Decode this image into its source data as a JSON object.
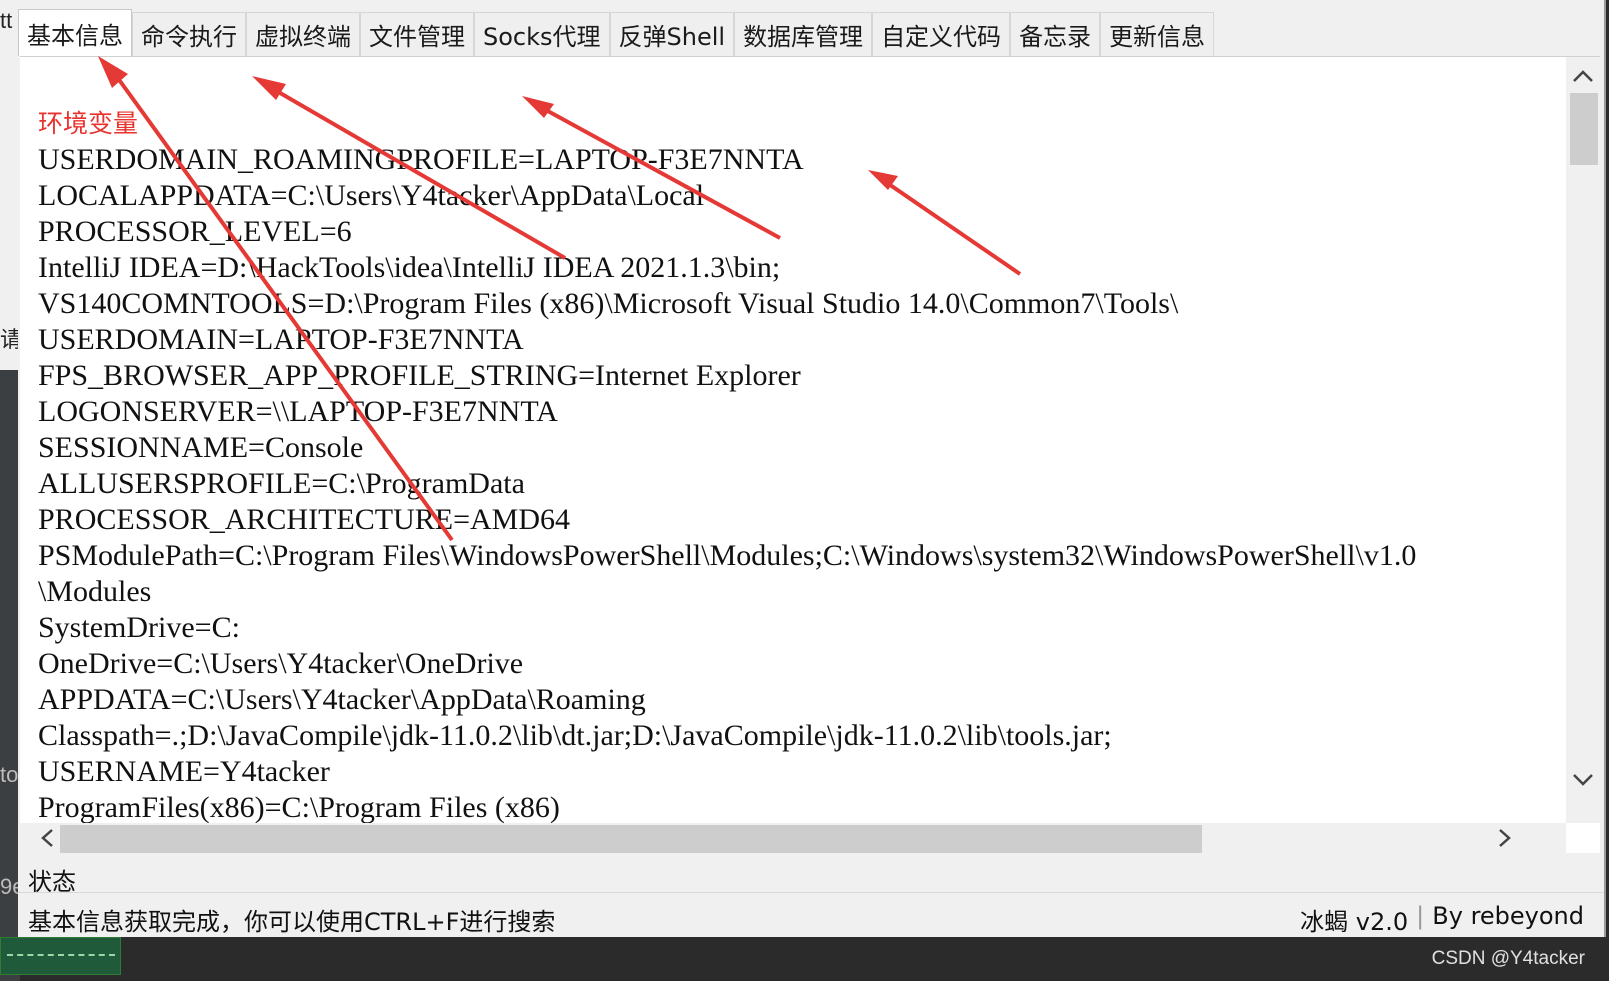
{
  "tabs": [
    {
      "label": "基本信息",
      "active": true
    },
    {
      "label": "命令执行"
    },
    {
      "label": "虚拟终端"
    },
    {
      "label": "文件管理"
    },
    {
      "label": "Socks代理"
    },
    {
      "label": "反弹Shell"
    },
    {
      "label": "数据库管理"
    },
    {
      "label": "自定义代码"
    },
    {
      "label": "备忘录"
    },
    {
      "label": "更新信息"
    }
  ],
  "content": {
    "section_title": "环境变量",
    "lines": [
      "USERDOMAIN_ROAMINGPROFILE=LAPTOP-F3E7NNTA",
      "LOCALAPPDATA=C:\\Users\\Y4tacker\\AppData\\Local",
      "PROCESSOR_LEVEL=6",
      "IntelliJ IDEA=D:\\HackTools\\idea\\IntelliJ IDEA 2021.1.3\\bin;",
      "VS140COMNTOOLS=D:\\Program Files (x86)\\Microsoft Visual Studio 14.0\\Common7\\Tools\\",
      "USERDOMAIN=LAPTOP-F3E7NNTA",
      "FPS_BROWSER_APP_PROFILE_STRING=Internet Explorer",
      "LOGONSERVER=\\\\LAPTOP-F3E7NNTA",
      "SESSIONNAME=Console",
      "ALLUSERSPROFILE=C:\\ProgramData",
      "PROCESSOR_ARCHITECTURE=AMD64",
      "PSModulePath=C:\\Program Files\\WindowsPowerShell\\Modules;C:\\Windows\\system32\\WindowsPowerShell\\v1.0",
      "\\Modules",
      "SystemDrive=C:",
      "OneDrive=C:\\Users\\Y4tacker\\OneDrive",
      "APPDATA=C:\\Users\\Y4tacker\\AppData\\Roaming",
      "Classpath=.;D:\\JavaCompile\\jdk-11.0.2\\lib\\dt.jar;D:\\JavaCompile\\jdk-11.0.2\\lib\\tools.jar;",
      "USERNAME=Y4tacker",
      "ProgramFiles(x86)=C:\\Program Files (x86)"
    ]
  },
  "status": {
    "label": "状态",
    "message": "基本信息获取完成，你可以使用CTRL+F进行搜索",
    "version": "冰蝎 v2.0",
    "author": "By rebeyond"
  },
  "background": {
    "frag_top": "tt",
    "frag_mid": "请",
    "frag_to": "to",
    "frag_9e": "9e"
  },
  "watermark": "CSDN @Y4tacker",
  "colors": {
    "section_title": "#e8322e",
    "annotation_arrows": "#e53935"
  }
}
